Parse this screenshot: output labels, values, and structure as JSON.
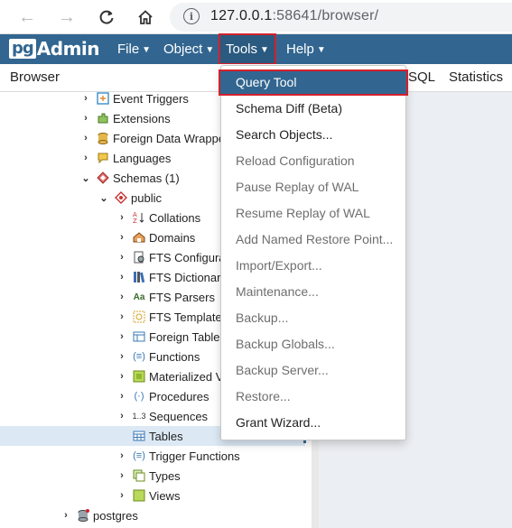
{
  "browser": {
    "back_icon": "arrow-left-icon",
    "forward_icon": "arrow-right-icon",
    "reload_icon": "reload-icon",
    "home_icon": "home-icon",
    "info_icon": "info-icon",
    "url_host": "127.0.0.1",
    "url_rest": ":58641/browser/"
  },
  "navbar": {
    "logo_pg": "pg",
    "logo_admin": "Admin",
    "menus": [
      {
        "label": "File"
      },
      {
        "label": "Object"
      },
      {
        "label": "Tools"
      },
      {
        "label": "Help"
      }
    ],
    "color": "#326690"
  },
  "tabs": {
    "browser": "Browser",
    "sql": "SQL",
    "statistics": "Statistics"
  },
  "tree": {
    "items": [
      {
        "label": "Event Triggers",
        "icon": "event-trigger-icon"
      },
      {
        "label": "Extensions",
        "icon": "extension-icon"
      },
      {
        "label": "Foreign Data Wrappe",
        "icon": "foreign-data-wrapper-icon"
      },
      {
        "label": "Languages",
        "icon": "language-icon"
      },
      {
        "label": "Schemas (1)",
        "icon": "schemas-icon"
      },
      {
        "label": "public",
        "icon": "schema-icon"
      },
      {
        "label": "Collations",
        "icon": "collation-icon"
      },
      {
        "label": "Domains",
        "icon": "domain-icon"
      },
      {
        "label": "FTS Configura",
        "icon": "fts-configuration-icon"
      },
      {
        "label": "FTS Dictionari",
        "icon": "fts-dictionary-icon"
      },
      {
        "label": "FTS Parsers",
        "icon": "fts-parser-icon"
      },
      {
        "label": "FTS Template",
        "icon": "fts-template-icon"
      },
      {
        "label": "Foreign Tables",
        "icon": "foreign-table-icon"
      },
      {
        "label": "Functions",
        "icon": "function-icon"
      },
      {
        "label": "Materialized V",
        "icon": "materialized-view-icon"
      },
      {
        "label": "Procedures",
        "icon": "procedure-icon"
      },
      {
        "label": "Sequences",
        "icon": "sequence-icon"
      },
      {
        "label": "Tables",
        "icon": "table-icon"
      },
      {
        "label": "Trigger Functions",
        "icon": "trigger-function-icon"
      },
      {
        "label": "Types",
        "icon": "type-icon"
      },
      {
        "label": "Views",
        "icon": "view-icon"
      },
      {
        "label": "postgres",
        "icon": "database-icon"
      }
    ],
    "selected": "Tables"
  },
  "tools_menu": {
    "items": [
      {
        "label": "Query Tool",
        "state": "active"
      },
      {
        "label": "Schema Diff (Beta)",
        "state": "enabled"
      },
      {
        "label": "Search Objects...",
        "state": "enabled"
      },
      {
        "label": "Reload Configuration",
        "state": "disabled"
      },
      {
        "label": "Pause Replay of WAL",
        "state": "disabled"
      },
      {
        "label": "Resume Replay of WAL",
        "state": "disabled"
      },
      {
        "label": "Add Named Restore Point...",
        "state": "disabled"
      },
      {
        "label": "Import/Export...",
        "state": "disabled"
      },
      {
        "label": "Maintenance...",
        "state": "disabled"
      },
      {
        "label": "Backup...",
        "state": "disabled"
      },
      {
        "label": "Backup Globals...",
        "state": "disabled"
      },
      {
        "label": "Backup Server...",
        "state": "disabled"
      },
      {
        "label": "Restore...",
        "state": "disabled"
      },
      {
        "label": "Grant Wizard...",
        "state": "enabled"
      }
    ],
    "highlight_color": "#d4202b"
  }
}
